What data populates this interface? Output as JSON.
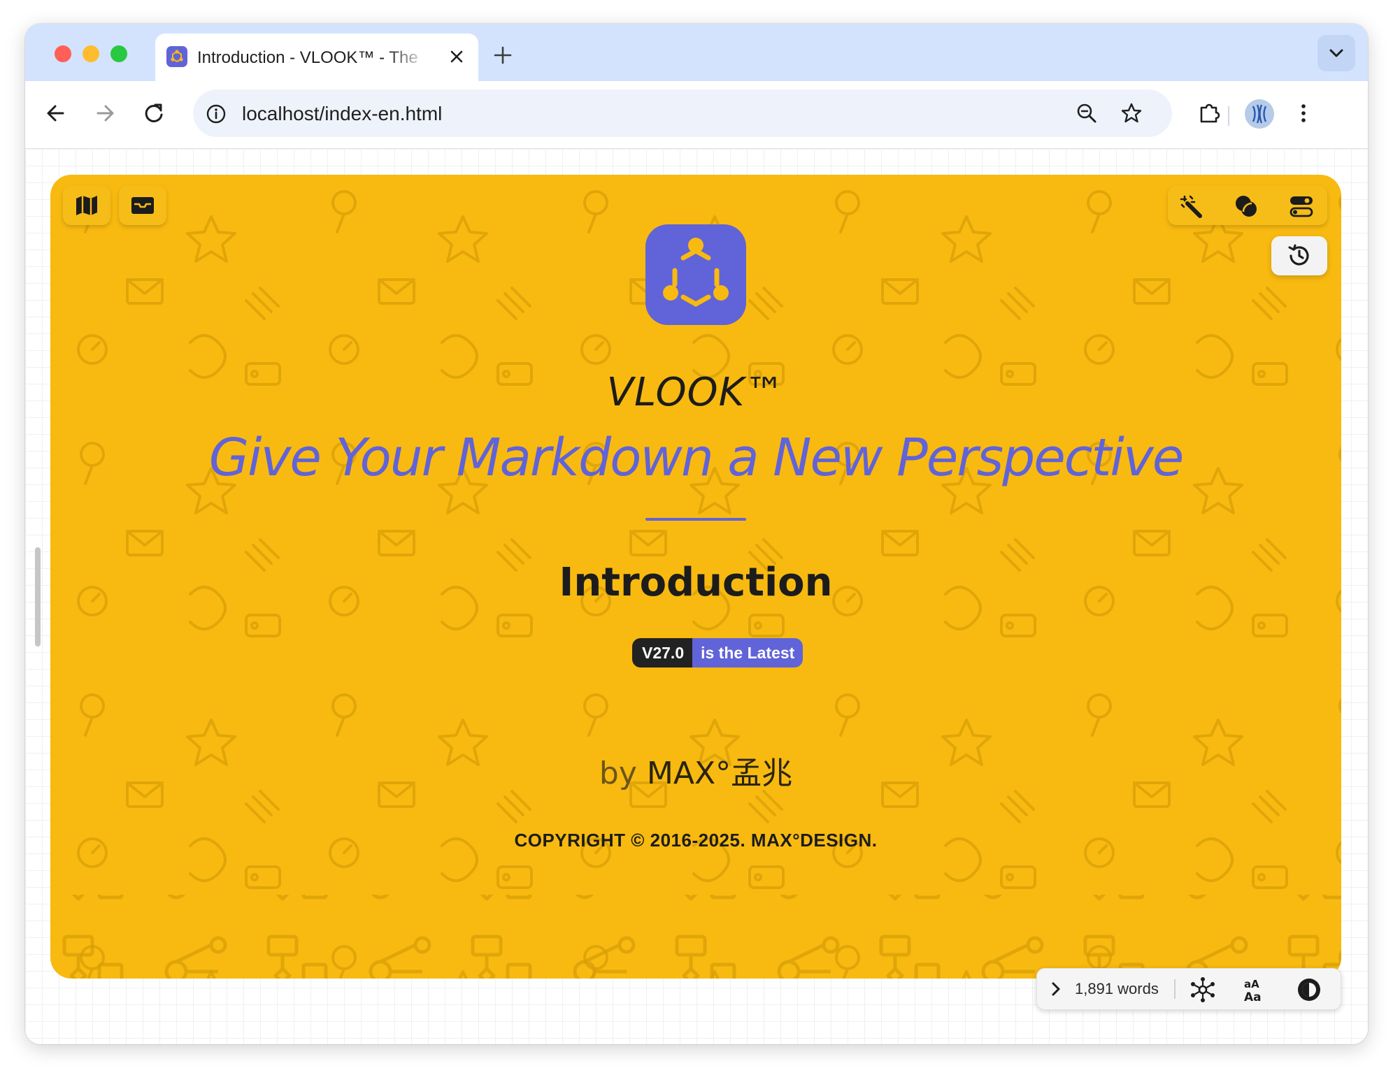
{
  "browser": {
    "tab_title": "Introduction - VLOOK™ - The",
    "url": "localhost/index-en.html",
    "favicon_color": "#6163d8",
    "tabstrip_color": "#d3e3fd"
  },
  "cover": {
    "background_color": "#f8ba10",
    "accent_color": "#6163d8",
    "title": "VLOOK™",
    "subtitle": "Give Your Markdown a New Perspective",
    "doc_title": "Introduction",
    "badge": {
      "version": "V27.0",
      "status": "is the Latest"
    },
    "byline_prefix": "by",
    "author": "MAX°孟兆",
    "copyright": "COPYRIGHT © 2016-2025. MAX°DESIGN."
  },
  "left_tools": [
    {
      "name": "map-icon"
    },
    {
      "name": "inbox-icon"
    }
  ],
  "right_tools": [
    {
      "name": "magic-wand-icon"
    },
    {
      "name": "theme-blend-icon"
    },
    {
      "name": "settings-toggle-icon"
    }
  ],
  "status_bar": {
    "word_count": "1,891 words",
    "icons": [
      "chevron-right-icon",
      "network-graph-icon",
      "font-size-icon",
      "contrast-icon"
    ]
  }
}
